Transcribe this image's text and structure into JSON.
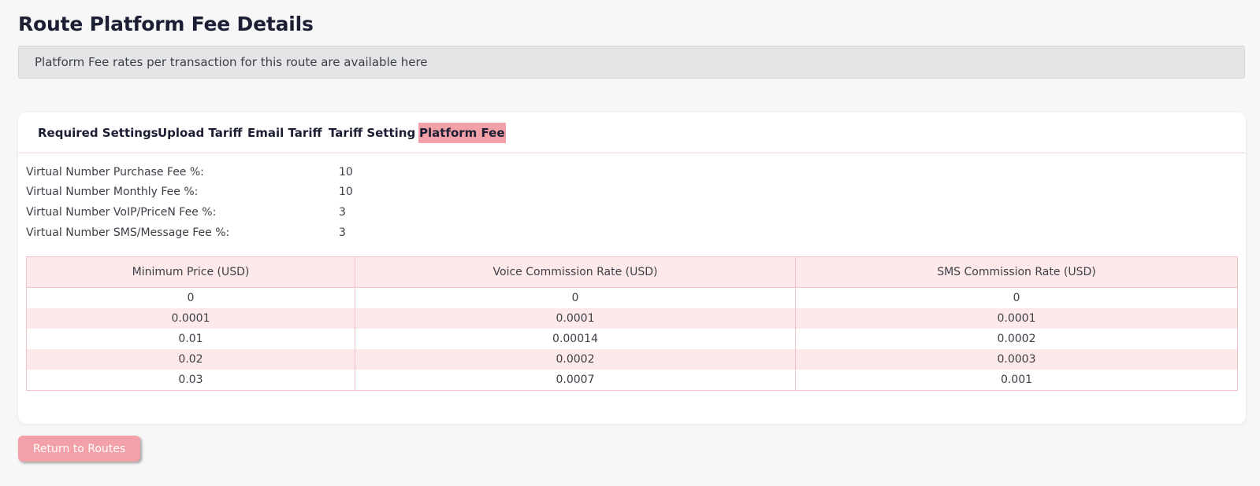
{
  "page": {
    "title": "Route Platform Fee Details",
    "info": "Platform Fee rates per transaction for this route are available here"
  },
  "tabs": [
    {
      "label": "Required Settings",
      "active": false
    },
    {
      "label": "Upload Tariff",
      "active": false
    },
    {
      "label": "Email Tariff",
      "active": false
    },
    {
      "label": "Tariff Setting",
      "active": false
    },
    {
      "label": "Platform Fee",
      "active": true
    }
  ],
  "fees": [
    {
      "label": "Virtual Number Purchase Fee %:",
      "value": "10"
    },
    {
      "label": "Virtual Number Monthly Fee %:",
      "value": "10"
    },
    {
      "label": "Virtual Number VoIP/PriceN Fee %:",
      "value": "3"
    },
    {
      "label": "Virtual Number SMS/Message Fee %:",
      "value": "3"
    }
  ],
  "table": {
    "headers": [
      "Minimum Price (USD)",
      "Voice Commission Rate (USD)",
      "SMS Commission Rate (USD)"
    ],
    "rows": [
      [
        "0",
        "0",
        "0"
      ],
      [
        "0.0001",
        "0.0001",
        "0.0001"
      ],
      [
        "0.01",
        "0.00014",
        "0.0002"
      ],
      [
        "0.02",
        "0.0002",
        "0.0003"
      ],
      [
        "0.03",
        "0.0007",
        "0.001"
      ]
    ]
  },
  "actions": {
    "return_label": "Return to Routes"
  },
  "colors": {
    "accent": "#f3a1a8",
    "row_stripe": "#fde9ea",
    "border": "#f2c3c8"
  }
}
